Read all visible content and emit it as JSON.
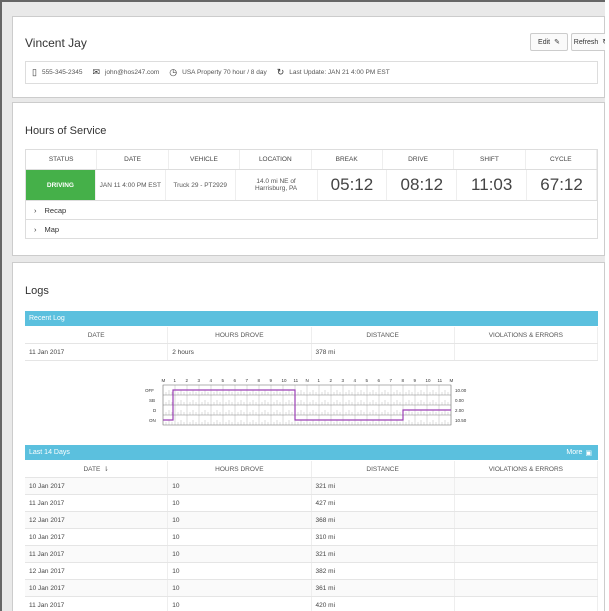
{
  "driver": {
    "name": "Vincent Jay",
    "edit_label": "Edit",
    "refresh_label": "Refresh",
    "phone": "555-345-2345",
    "email": "john@hos247.com",
    "ruleset": "USA Property 70 hour / 8 day",
    "last_update": "Last Update: JAN 21 4:00 PM EST"
  },
  "hos": {
    "title": "Hours of Service",
    "headers": [
      "STATUS",
      "DATE",
      "VEHICLE",
      "LOCATION",
      "BREAK",
      "DRIVE",
      "SHIFT",
      "CYCLE"
    ],
    "row": {
      "status": "DRIVING",
      "date": "JAN 11 4:00 PM EST",
      "vehicle": "Truck 29 - PT2929",
      "location": "14.0 mi NE of Harrisburg, PA",
      "break": "05:12",
      "drive": "08:12",
      "shift": "11:03",
      "cycle": "67:12"
    },
    "recap_label": "Recap",
    "map_label": "Map"
  },
  "logs": {
    "title": "Logs",
    "recent_label": "Recent Log",
    "headers": [
      "DATE",
      "HOURS DROVE",
      "DISTANCE",
      "VIOLATIONS & ERRORS"
    ],
    "recent_row": {
      "date": "11 Jan 2017",
      "hours": "2 hours",
      "distance": "378 mi",
      "violations": ""
    },
    "graph": {
      "hour_labels": [
        "M",
        "1",
        "2",
        "3",
        "4",
        "5",
        "6",
        "7",
        "8",
        "9",
        "10",
        "11",
        "N",
        "1",
        "2",
        "3",
        "4",
        "5",
        "6",
        "7",
        "8",
        "9",
        "10",
        "11",
        "M"
      ],
      "status_labels": [
        "OFF",
        "SB",
        "D",
        "ON"
      ],
      "totals": [
        "10.00",
        "0.00",
        "2.00",
        "10.50"
      ]
    },
    "last14_label": "Last 14 Days",
    "more_label": "More",
    "last14_headers": [
      "DATE",
      "HOURS DROVE",
      "DISTANCE",
      "VIOLATIONS & ERRORS"
    ],
    "rows": [
      {
        "date": "10 Jan 2017",
        "hours": "10",
        "distance": "321 mi"
      },
      {
        "date": "11 Jan 2017",
        "hours": "10",
        "distance": "427 mi"
      },
      {
        "date": "12 Jan 2017",
        "hours": "10",
        "distance": "368 mi"
      },
      {
        "date": "10 Jan 2017",
        "hours": "10",
        "distance": "310 mi"
      },
      {
        "date": "11 Jan 2017",
        "hours": "10",
        "distance": "321 mi"
      },
      {
        "date": "12 Jan 2017",
        "hours": "10",
        "distance": "382 mi"
      },
      {
        "date": "10 Jan 2017",
        "hours": "10",
        "distance": "361 mi"
      },
      {
        "date": "11 Jan 2017",
        "hours": "10",
        "distance": "420 mi"
      }
    ]
  },
  "colors": {
    "accent": "#5bc0de",
    "driving": "#45b049",
    "graph_line": "#9b3fb5"
  },
  "icons": [
    "phone-icon",
    "mail-icon",
    "clock-icon",
    "refresh-icon",
    "pencil-icon",
    "chevron-right-icon",
    "calendar-icon",
    "sort-icon"
  ]
}
